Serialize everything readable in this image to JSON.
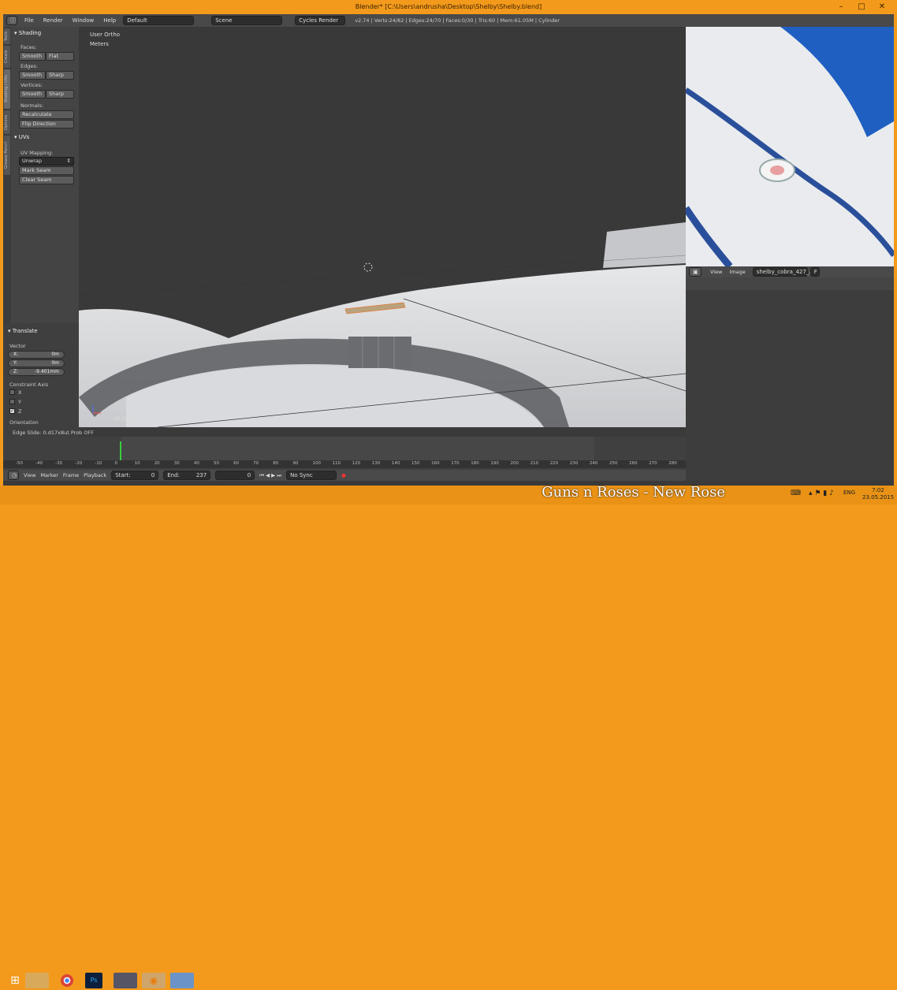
{
  "window": {
    "title": "Blender* [C:\\Users\\andrusha\\Desktop\\Shelby\\Shelby.blend]"
  },
  "menu": {
    "items": [
      "File",
      "Render",
      "Window",
      "Help"
    ],
    "layout": "Default",
    "scene": "Scene",
    "engine": "Cycles Render",
    "stats": "v2.74 | Verts:24/82 | Edges:24/70 | Faces:0/30 | Tris:60 | Mem:61.05M | Cylinder"
  },
  "tabs": [
    "Tools",
    "Create",
    "Shading / UVs",
    "Options",
    "Grease Pencil"
  ],
  "shading": {
    "title": "Shading",
    "faces_label": "Faces:",
    "smooth": "Smooth",
    "flat": "Flat",
    "edges_label": "Edges:",
    "sharp": "Sharp",
    "vertices_label": "Vertices:",
    "normals_label": "Normals:",
    "recalculate": "Recalculate",
    "flip": "Flip Direction"
  },
  "uvs": {
    "title": "UVs",
    "mapping_label": "UV Mapping:",
    "unwrap": "Unwrap",
    "mark_seam": "Mark Seam",
    "clear_seam": "Clear Seam"
  },
  "translate": {
    "title": "Translate",
    "vector_label": "Vector",
    "x_label": "X:",
    "x": "0m",
    "y_label": "Y:",
    "y": "0m",
    "z_label": "Z:",
    "z": "-9.401mm",
    "constraint_label": "Constraint Axis",
    "cx": "X",
    "cy": "Y",
    "cz": "Z",
    "orientation_label": "Orientation"
  },
  "status_line": "Edge Slide: 0.d17x8ut Prob OFF",
  "viewport": {
    "view": "User Ortho",
    "units": "Meters",
    "object": "(0) Cylinder"
  },
  "image_editor": {
    "view": "View",
    "image": "Image",
    "image_name": "shelby_cobra_427_...",
    "f_label": "F"
  },
  "timeline": {
    "ticks": [
      "-50",
      "-40",
      "-30",
      "-20",
      "-10",
      "0",
      "10",
      "20",
      "30",
      "40",
      "50",
      "60",
      "70",
      "80",
      "90",
      "100",
      "110",
      "120",
      "130",
      "140",
      "150",
      "160",
      "170",
      "180",
      "190",
      "200",
      "210",
      "220",
      "230",
      "240",
      "250",
      "260",
      "270",
      "280"
    ],
    "view": "View",
    "marker": "Marker",
    "frame": "Frame",
    "playback": "Playback",
    "start_label": "Start:",
    "start": "0",
    "end_label": "End:",
    "end": "237",
    "current": "0",
    "sync": "No Sync"
  },
  "taskbar": {
    "caption": "Guns n Roses - New Rose",
    "lang": "ENG",
    "time": "7:02",
    "date": "23.05.2015"
  },
  "colors": {
    "accent": "#f39a1c",
    "panel": "#444444",
    "viewport": "#393939"
  }
}
